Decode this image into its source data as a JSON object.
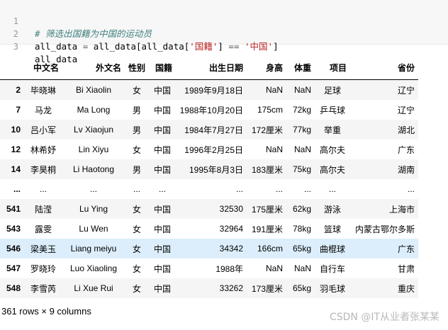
{
  "code": {
    "line_numbers": [
      "1",
      "2",
      "3"
    ],
    "line1_comment": "# 筛选出国籍为中国的运动员",
    "line2": {
      "lhs": "all_data",
      "assign": " = ",
      "obj": "all_data",
      "open": "[",
      "inner_obj": "all_data",
      "inner_open": "[",
      "key": "'国籍'",
      "inner_close": "]",
      "op": " == ",
      "value": "'中国'",
      "close": "]"
    },
    "line3": "all_data"
  },
  "table": {
    "columns": [
      "",
      "中文名",
      "外文名",
      "性别",
      "国籍",
      "出生日期",
      "身高",
      "体重",
      "项目",
      "省份"
    ],
    "rows": [
      {
        "idx": "2",
        "cn": "毕晓琳",
        "en": "Bi Xiaolin",
        "sex": "女",
        "nat": "中国",
        "dob": "1989年9月18日",
        "ht": "NaN",
        "wt": "NaN",
        "sp": "足球",
        "pv": "辽宁"
      },
      {
        "idx": "7",
        "cn": "马龙",
        "en": "Ma Long",
        "sex": "男",
        "nat": "中国",
        "dob": "1988年10月20日",
        "ht": "175cm",
        "wt": "72kg",
        "sp": "乒乓球",
        "pv": "辽宁"
      },
      {
        "idx": "10",
        "cn": "吕小军",
        "en": "Lv Xiaojun",
        "sex": "男",
        "nat": "中国",
        "dob": "1984年7月27日",
        "ht": "172厘米",
        "wt": "77kg",
        "sp": "举重",
        "pv": "湖北"
      },
      {
        "idx": "12",
        "cn": "林希妤",
        "en": "Lin Xiyu",
        "sex": "女",
        "nat": "中国",
        "dob": "1996年2月25日",
        "ht": "NaN",
        "wt": "NaN",
        "sp": "高尔夫",
        "pv": "广东"
      },
      {
        "idx": "14",
        "cn": "李昊桐",
        "en": "Li Haotong",
        "sex": "男",
        "nat": "中国",
        "dob": "1995年8月3日",
        "ht": "183厘米",
        "wt": "75kg",
        "sp": "高尔夫",
        "pv": "湖南"
      },
      {
        "idx": "...",
        "cn": "...",
        "en": "...",
        "sex": "...",
        "nat": "...",
        "dob": "...",
        "ht": "...",
        "wt": "...",
        "sp": "...",
        "pv": "..."
      },
      {
        "idx": "541",
        "cn": "陆滢",
        "en": "Lu Ying",
        "sex": "女",
        "nat": "中国",
        "dob": "32530",
        "ht": "175厘米",
        "wt": "62kg",
        "sp": "游泳",
        "pv": "上海市"
      },
      {
        "idx": "543",
        "cn": "露雯",
        "en": "Lu Wen",
        "sex": "女",
        "nat": "中国",
        "dob": "32964",
        "ht": "191厘米",
        "wt": "78kg",
        "sp": "篮球",
        "pv": "内蒙古鄂尔多斯"
      },
      {
        "idx": "546",
        "cn": "梁美玉",
        "en": "Liang meiyu",
        "sex": "女",
        "nat": "中国",
        "dob": "34342",
        "ht": "166cm",
        "wt": "65kg",
        "sp": "曲棍球",
        "pv": "广东",
        "selected": true
      },
      {
        "idx": "547",
        "cn": "罗晓玲",
        "en": "Luo Xiaoling",
        "sex": "女",
        "nat": "中国",
        "dob": "1988年",
        "ht": "NaN",
        "wt": "NaN",
        "sp": "自行车",
        "pv": "甘肃"
      },
      {
        "idx": "548",
        "cn": "李雪芮",
        "en": "Li Xue Rui",
        "sex": "女",
        "nat": "中国",
        "dob": "33262",
        "ht": "173厘米",
        "wt": "65kg",
        "sp": "羽毛球",
        "pv": "重庆"
      }
    ]
  },
  "footer": "361 rows × 9 columns",
  "watermark": "CSDN @IT从业者张某某"
}
